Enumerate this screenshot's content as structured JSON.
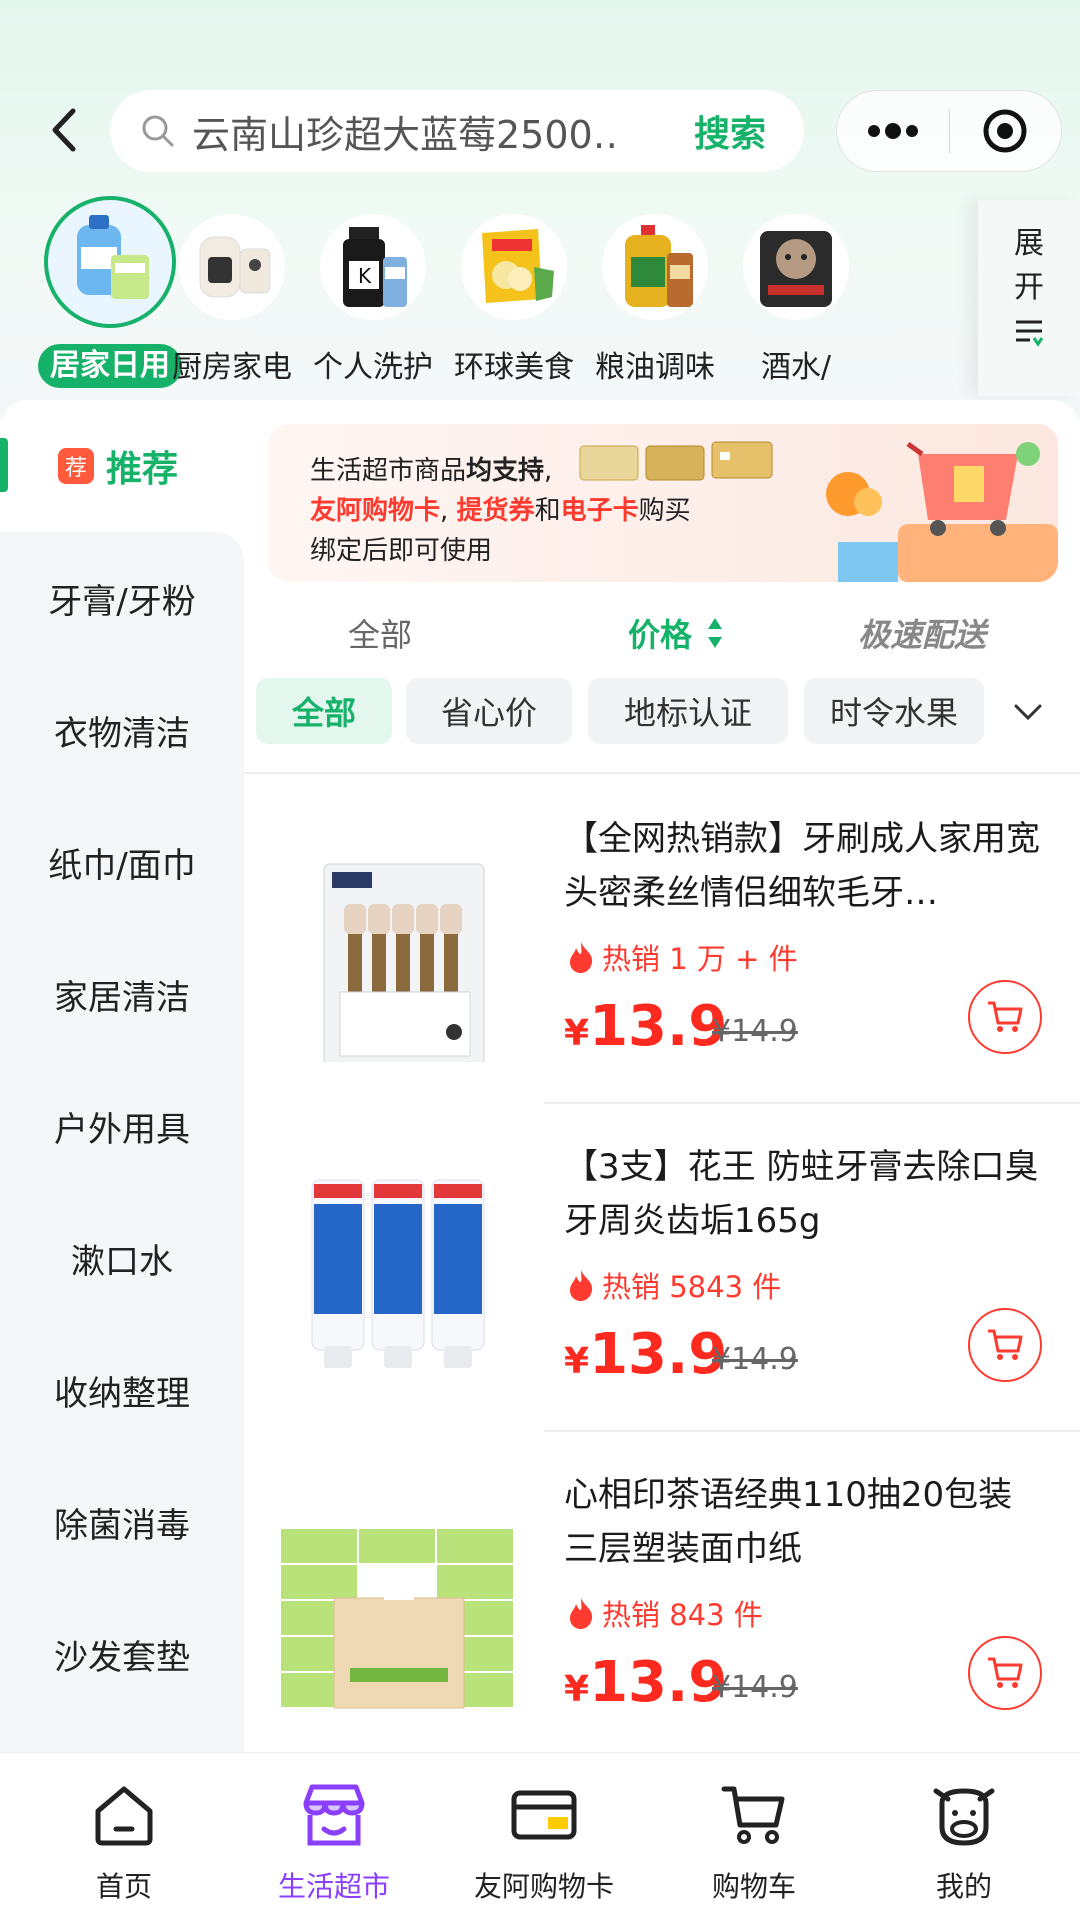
{
  "header": {
    "search_text": "云南山珍超大蓝莓2500…",
    "search_button": "搜索"
  },
  "categories": [
    {
      "label": "居家日用",
      "icon": "detergent-product-icon",
      "active": true
    },
    {
      "label": "厨房家电",
      "icon": "air-fryer-product-icon"
    },
    {
      "label": "个人洗护",
      "icon": "shampoo-product-icon"
    },
    {
      "label": "环球美食",
      "icon": "snack-product-icon"
    },
    {
      "label": "粮油调味",
      "icon": "oil-product-icon"
    },
    {
      "label": "酒水/",
      "icon": "petfood-product-icon"
    }
  ],
  "expand": {
    "line1": "展",
    "line2": "开"
  },
  "sidebar": {
    "recommend_tag": "荐",
    "recommend_label": "推荐",
    "items": [
      "牙膏/牙粉",
      "衣物清洁",
      "纸巾/面巾",
      "家居清洁",
      "户外用具",
      "漱口水",
      "收纳整理",
      "除菌消毒",
      "沙发套垫"
    ]
  },
  "banner": {
    "l1_a": "生活超市商品",
    "l1_b": "均支持",
    "l1_c": ",",
    "l2_a": "友阿购物卡",
    "l2_b": ", ",
    "l2_c": "提货券",
    "l2_d": "和",
    "l2_e": "电子卡",
    "l2_f": "购买",
    "l3": "绑定后即可使用"
  },
  "sort": {
    "all": "全部",
    "price": "价格",
    "fast": "极速配送"
  },
  "chips": [
    "全部",
    "省心价",
    "地标认证",
    "时令水果"
  ],
  "products": [
    {
      "title": "【全网热销款】牙刷成人家用宽头密柔丝情侣细软毛牙…",
      "hot": "热销 1 万 + 件",
      "currency": "¥",
      "price": "13.9",
      "old_price": "¥14.9"
    },
    {
      "title": "【3支】花王 防蛀牙膏去除口臭牙周炎齿垢165g",
      "hot": "热销 5843 件",
      "currency": "¥",
      "price": "13.9",
      "old_price": "¥14.9"
    },
    {
      "title": "心相印茶语经典110抽20包装三层塑装面巾纸",
      "hot": "热销 843 件",
      "currency": "¥",
      "price": "13.9",
      "old_price": "¥14.9"
    }
  ],
  "nav": [
    "首页",
    "生活超市",
    "友阿购物卡",
    "购物车",
    "我的"
  ],
  "colors": {
    "brand_green": "#17b26a",
    "price_red": "#ff2a1f",
    "active_nav": "#8a3ffc"
  }
}
